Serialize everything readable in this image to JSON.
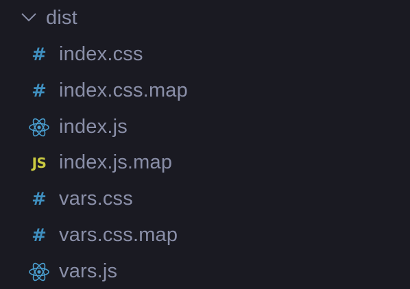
{
  "folder": {
    "name": "dist",
    "expanded": true,
    "icon": "chevron-down-icon"
  },
  "files": [
    {
      "name": "index.css",
      "icon": "css-hash-icon"
    },
    {
      "name": "index.css.map",
      "icon": "css-hash-icon"
    },
    {
      "name": "index.js",
      "icon": "react-atom-icon"
    },
    {
      "name": "index.js.map",
      "icon": "js-file-icon",
      "icon_text": "JS"
    },
    {
      "name": "vars.css",
      "icon": "css-hash-icon"
    },
    {
      "name": "vars.css.map",
      "icon": "css-hash-icon"
    },
    {
      "name": "vars.js",
      "icon": "react-atom-icon"
    }
  ],
  "colors": {
    "background": "#1a1a22",
    "label": "#8a8fa8",
    "css_icon": "#3f8fbf",
    "react_icon": "#4a9fd0",
    "js_icon": "#cbcb41"
  }
}
